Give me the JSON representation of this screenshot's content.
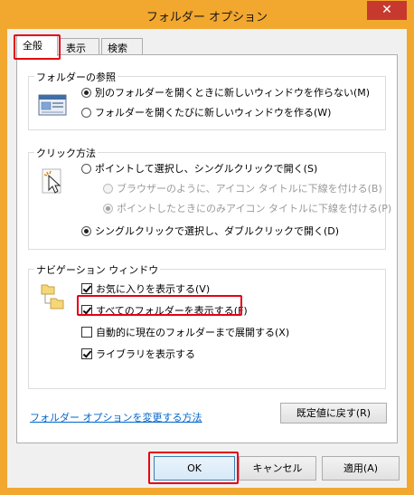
{
  "window": {
    "title": "フォルダー オプション",
    "close_glyph": "✕"
  },
  "tabs": [
    {
      "label": "全般",
      "active": true
    },
    {
      "label": "表示",
      "active": false
    },
    {
      "label": "検索",
      "active": false
    }
  ],
  "browse_folders": {
    "title": "フォルダーの参照",
    "icon": "window-icon",
    "options": [
      {
        "label": "別のフォルダーを開くときに新しいウィンドウを作らない(M)",
        "checked": true
      },
      {
        "label": "フォルダーを開くたびに新しいウィンドウを作る(W)",
        "checked": false
      }
    ]
  },
  "click_method": {
    "title": "クリック方法",
    "icon": "pointer-click-icon",
    "single_click": {
      "label": "ポイントして選択し、シングルクリックで開く(S)",
      "checked": false
    },
    "sub_options": [
      {
        "label": "ブラウザーのように、アイコン タイトルに下線を付ける(B)",
        "checked": false,
        "disabled": true
      },
      {
        "label": "ポイントしたときにのみアイコン タイトルに下線を付ける(P)",
        "checked": true,
        "disabled": true
      }
    ],
    "double_click": {
      "label": "シングルクリックで選択し、ダブルクリックで開く(D)",
      "checked": true
    }
  },
  "navigation_pane": {
    "title": "ナビゲーション ウィンドウ",
    "icon": "folder-tree-icon",
    "options": [
      {
        "label": "お気に入りを表示する(V)",
        "checked": true
      },
      {
        "label": "すべてのフォルダーを表示する(F)",
        "checked": true
      },
      {
        "label": "自動的に現在のフォルダーまで展開する(X)",
        "checked": false
      },
      {
        "label": "ライブラリを表示する",
        "checked": true
      }
    ]
  },
  "restore_defaults_label": "既定値に戻す(R)",
  "help_link": "フォルダー オプションを変更する方法",
  "footer": {
    "ok_label": "OK",
    "cancel_label": "キャンセル",
    "apply_label": "適用(A)"
  },
  "colors": {
    "accent_title": "#f2a72e",
    "highlight_red": "#e60012",
    "link_blue": "#0066cc"
  }
}
